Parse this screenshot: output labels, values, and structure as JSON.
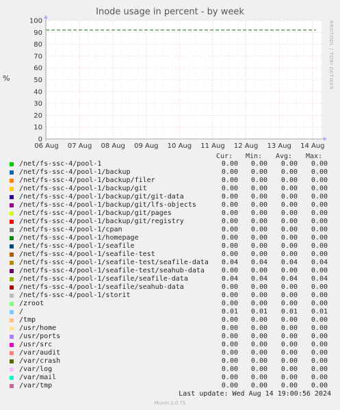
{
  "chart_data": {
    "type": "line",
    "title": "Inode usage in percent - by week",
    "ylabel": "%",
    "ylim": [
      0,
      100
    ],
    "yticks": [
      0,
      10,
      20,
      30,
      40,
      50,
      60,
      70,
      80,
      90,
      100
    ],
    "xticks": [
      "06 Aug",
      "07 Aug",
      "08 Aug",
      "09 Aug",
      "10 Aug",
      "11 Aug",
      "12 Aug",
      "13 Aug",
      "14 Aug"
    ],
    "grid": true,
    "warning_level": 92,
    "series": [
      {
        "name": "/net/fs-ssc-4/pool-1",
        "color": "#00cc00",
        "cur": "0.00",
        "min": "0.00",
        "avg": "0.00",
        "max": "0.00"
      },
      {
        "name": "/net/fs-ssc-4/pool-1/backup",
        "color": "#0066b3",
        "cur": "0.00",
        "min": "0.00",
        "avg": "0.00",
        "max": "0.00"
      },
      {
        "name": "/net/fs-ssc-4/pool-1/backup/filer",
        "color": "#ff8000",
        "cur": "0.00",
        "min": "0.00",
        "avg": "0.00",
        "max": "0.00"
      },
      {
        "name": "/net/fs-ssc-4/pool-1/backup/git",
        "color": "#ffcc00",
        "cur": "0.00",
        "min": "0.00",
        "avg": "0.00",
        "max": "0.00"
      },
      {
        "name": "/net/fs-ssc-4/pool-1/backup/git/git-data",
        "color": "#330099",
        "cur": "0.00",
        "min": "0.00",
        "avg": "0.00",
        "max": "0.00"
      },
      {
        "name": "/net/fs-ssc-4/pool-1/backup/git/lfs-objects",
        "color": "#990099",
        "cur": "0.00",
        "min": "0.00",
        "avg": "0.00",
        "max": "0.00"
      },
      {
        "name": "/net/fs-ssc-4/pool-1/backup/git/pages",
        "color": "#ccff00",
        "cur": "0.00",
        "min": "0.00",
        "avg": "0.00",
        "max": "0.00"
      },
      {
        "name": "/net/fs-ssc-4/pool-1/backup/git/registry",
        "color": "#ff0000",
        "cur": "0.00",
        "min": "0.00",
        "avg": "0.00",
        "max": "0.00"
      },
      {
        "name": "/net/fs-ssc-4/pool-1/cpan",
        "color": "#808080",
        "cur": "0.00",
        "min": "0.00",
        "avg": "0.00",
        "max": "0.00"
      },
      {
        "name": "/net/fs-ssc-4/pool-1/homepage",
        "color": "#008f00",
        "cur": "0.00",
        "min": "0.00",
        "avg": "0.00",
        "max": "0.00"
      },
      {
        "name": "/net/fs-ssc-4/pool-1/seafile",
        "color": "#00487d",
        "cur": "0.00",
        "min": "0.00",
        "avg": "0.00",
        "max": "0.00"
      },
      {
        "name": "/net/fs-ssc-4/pool-1/seafile-test",
        "color": "#b35a00",
        "cur": "0.00",
        "min": "0.00",
        "avg": "0.00",
        "max": "0.00"
      },
      {
        "name": "/net/fs-ssc-4/pool-1/seafile-test/seafile-data",
        "color": "#b38f00",
        "cur": "0.04",
        "min": "0.04",
        "avg": "0.04",
        "max": "0.04"
      },
      {
        "name": "/net/fs-ssc-4/pool-1/seafile-test/seahub-data",
        "color": "#6b006b",
        "cur": "0.00",
        "min": "0.00",
        "avg": "0.00",
        "max": "0.00"
      },
      {
        "name": "/net/fs-ssc-4/pool-1/seafile/seafile-data",
        "color": "#8fb300",
        "cur": "0.04",
        "min": "0.04",
        "avg": "0.04",
        "max": "0.04"
      },
      {
        "name": "/net/fs-ssc-4/pool-1/seafile/seahub-data",
        "color": "#b30000",
        "cur": "0.00",
        "min": "0.00",
        "avg": "0.00",
        "max": "0.00"
      },
      {
        "name": "/net/fs-ssc-4/pool-1/storit",
        "color": "#bebebe",
        "cur": "0.00",
        "min": "0.00",
        "avg": "0.00",
        "max": "0.00"
      },
      {
        "name": "/zroot",
        "color": "#80ff80",
        "cur": "0.00",
        "min": "0.00",
        "avg": "0.00",
        "max": "0.00"
      },
      {
        "name": "/",
        "color": "#80c9ff",
        "cur": "0.01",
        "min": "0.01",
        "avg": "0.01",
        "max": "0.01"
      },
      {
        "name": "/tmp",
        "color": "#ffc080",
        "cur": "0.00",
        "min": "0.00",
        "avg": "0.00",
        "max": "0.00"
      },
      {
        "name": "/usr/home",
        "color": "#ffe680",
        "cur": "0.00",
        "min": "0.00",
        "avg": "0.00",
        "max": "0.00"
      },
      {
        "name": "/usr/ports",
        "color": "#aa80ff",
        "cur": "0.00",
        "min": "0.00",
        "avg": "0.00",
        "max": "0.00"
      },
      {
        "name": "/usr/src",
        "color": "#ee00cc",
        "cur": "0.00",
        "min": "0.00",
        "avg": "0.00",
        "max": "0.00"
      },
      {
        "name": "/var/audit",
        "color": "#ff8080",
        "cur": "0.00",
        "min": "0.00",
        "avg": "0.00",
        "max": "0.00"
      },
      {
        "name": "/var/crash",
        "color": "#666600",
        "cur": "0.00",
        "min": "0.00",
        "avg": "0.00",
        "max": "0.00"
      },
      {
        "name": "/var/log",
        "color": "#ffbfff",
        "cur": "0.00",
        "min": "0.00",
        "avg": "0.00",
        "max": "0.00"
      },
      {
        "name": "/var/mail",
        "color": "#00ffcc",
        "cur": "0.00",
        "min": "0.00",
        "avg": "0.00",
        "max": "0.00"
      },
      {
        "name": "/var/tmp",
        "color": "#cc6699",
        "cur": "0.00",
        "min": "0.00",
        "avg": "0.00",
        "max": "0.00"
      }
    ]
  },
  "legend": {
    "cur": "Cur:",
    "min": "Min:",
    "avg": "Avg:",
    "max": "Max:"
  },
  "side_text": "RRDTOOL / TOBI OETIKER",
  "footer": "Last update: Wed Aug 14 19:00:56 2024",
  "version": "Munin 2.0.75",
  "colors": {
    "background": "#f0f0f0",
    "plot": "#ffffff",
    "grid": "#e8b4b4",
    "warning": "#008000"
  }
}
